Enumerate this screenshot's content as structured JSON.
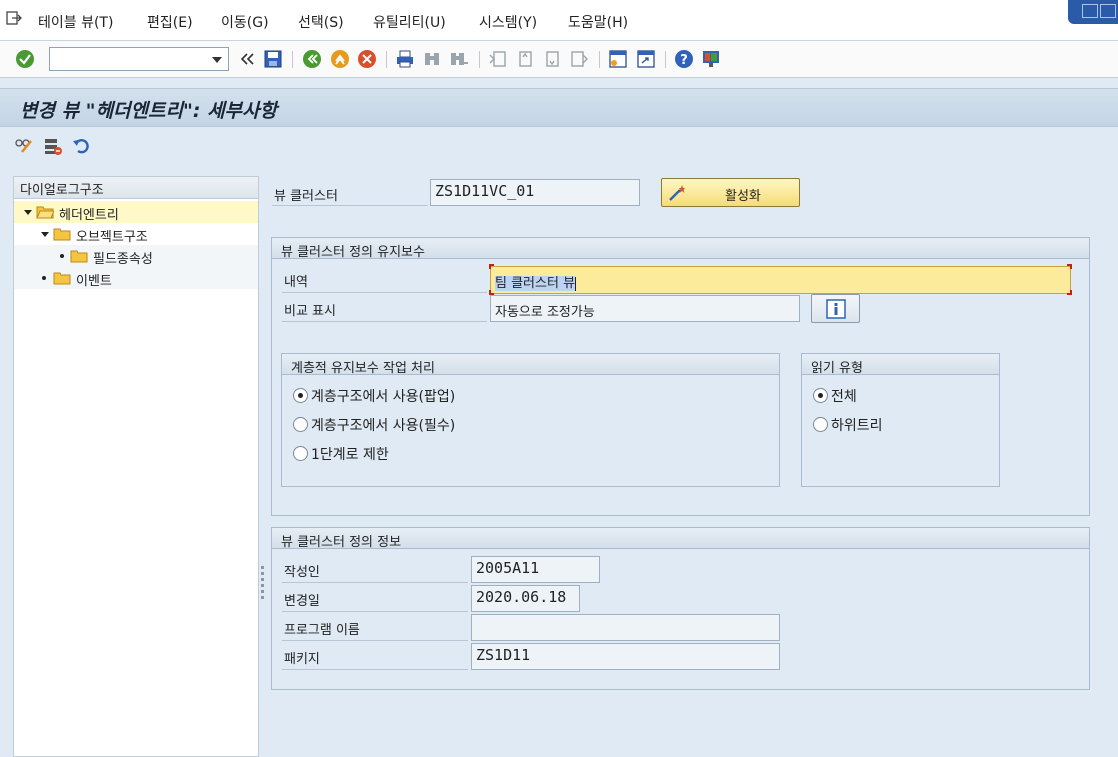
{
  "menu": {
    "items": [
      "테이블 뷰(T)",
      "편집(E)",
      "이동(G)",
      "선택(S)",
      "유틸리티(U)",
      "시스템(Y)",
      "도움말(H)"
    ]
  },
  "toolbar": {
    "command_value": "",
    "icons": [
      "check-icon",
      "history-back-icon",
      "save-icon",
      "back-icon",
      "exit-icon",
      "cancel-icon",
      "print-icon",
      "find-icon",
      "find-next-icon",
      "first-page-icon",
      "prev-page-icon",
      "next-page-icon",
      "last-page-icon",
      "new-session-icon",
      "shortcut-icon",
      "help-icon",
      "layout-icon"
    ]
  },
  "title": "변경 뷰 \"헤더엔트리\": 세부사항",
  "tree": {
    "header": "다이얼로그구조",
    "nodes": [
      {
        "label": "헤더엔트리",
        "level": 0,
        "expanded": true,
        "selected": true
      },
      {
        "label": "오브젝트구조",
        "level": 1,
        "expanded": true,
        "selected": false
      },
      {
        "label": "필드종속성",
        "level": 2,
        "expanded": false,
        "selected": false
      },
      {
        "label": "이벤트",
        "level": 1,
        "expanded": false,
        "selected": false
      }
    ]
  },
  "cluster": {
    "label": "뷰 클러스터",
    "value": "ZS1D11VC_01",
    "activate_label": "활성화"
  },
  "maintenance": {
    "title": "뷰 클러스터 정의 유지보수",
    "desc_label": "내역",
    "desc_value": "팀 클러스터 뷰",
    "compare_label": "비교 표시",
    "compare_value": "자동으로 조정가능",
    "hier": {
      "title": "계층적 유지보수 작업 처리",
      "options": [
        {
          "label": "계층구조에서 사용(팝업)",
          "selected": true
        },
        {
          "label": "계층구조에서 사용(필수)",
          "selected": false
        },
        {
          "label": "1단계로 제한",
          "selected": false
        }
      ]
    },
    "read": {
      "title": "읽기 유형",
      "options": [
        {
          "label": "전체",
          "selected": true
        },
        {
          "label": "하위트리",
          "selected": false
        }
      ]
    }
  },
  "info": {
    "title": "뷰 클러스터 정의 정보",
    "author_label": "작성인",
    "author_value": "2005A11",
    "changed_label": "변경일",
    "changed_value": "2020.06.18",
    "program_label": "프로그램 이름",
    "program_value": "",
    "package_label": "패키지",
    "package_value": "ZS1D11"
  },
  "colors": {
    "background": "#dfeaf4",
    "title_bar": "#c3d4e6",
    "selected_tree": "#fff9c7",
    "highlight_input": "#fdeb9c",
    "activate_button": "#f6dc77"
  }
}
